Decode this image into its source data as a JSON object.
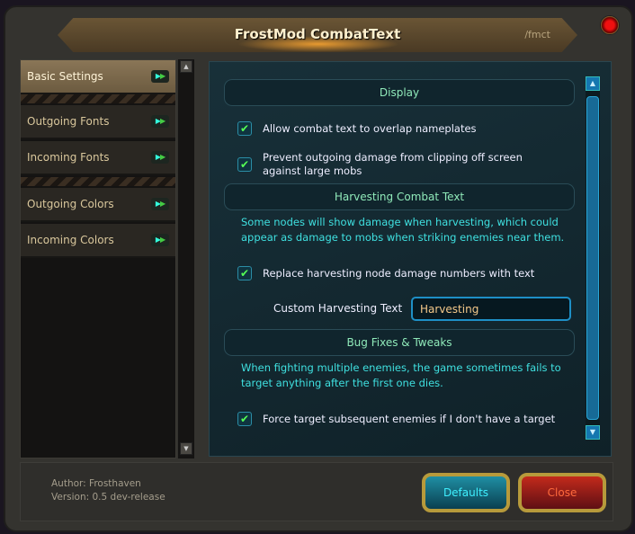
{
  "window": {
    "title": "FrostMod CombatText",
    "command": "/fmct"
  },
  "sidebar": {
    "items": [
      {
        "label": "Basic Settings",
        "selected": true
      },
      {
        "label": "Outgoing Fonts",
        "selected": false
      },
      {
        "label": "Incoming Fonts",
        "selected": false
      },
      {
        "label": "Outgoing Colors",
        "selected": false
      },
      {
        "label": "Incoming Colors",
        "selected": false
      }
    ]
  },
  "content": {
    "display": {
      "header": "Display",
      "options": [
        {
          "label": "Allow combat text to overlap nameplates",
          "checked": true
        },
        {
          "label": "Prevent outgoing damage from clipping off screen against large mobs",
          "checked": true
        }
      ]
    },
    "harvesting": {
      "header": "Harvesting Combat Text",
      "description": "Some nodes will show damage when harvesting, which could appear as damage to mobs when striking enemies near them.",
      "option": {
        "label": "Replace harvesting node damage numbers with text",
        "checked": true
      },
      "custom_label": "Custom Harvesting Text",
      "custom_value": "Harvesting"
    },
    "bugfixes": {
      "header": "Bug Fixes & Tweaks",
      "description": "When fighting multiple enemies, the game sometimes fails to target anything after the first one dies.",
      "option": {
        "label": "Force target subsequent enemies if I don't have a target",
        "checked": true
      }
    }
  },
  "footer": {
    "author": "Author: Frosthaven",
    "version": "Version: 0.5 dev-release",
    "defaults_label": "Defaults",
    "close_label": "Close"
  },
  "colors": {
    "accent": "#3fe0e0",
    "header": "#8fe9b9",
    "close": "#c32a1b"
  }
}
